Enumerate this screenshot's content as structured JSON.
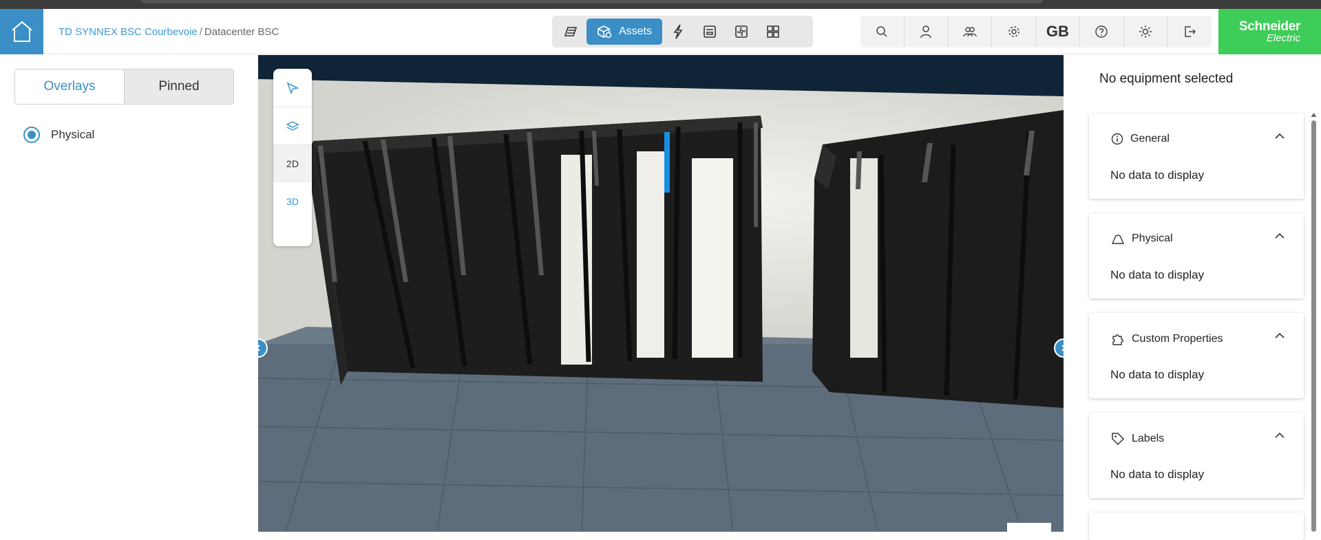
{
  "header": {
    "breadcrumb": {
      "site": "TD SYNNEX BSC Courbevoie",
      "separator": "/",
      "current": "Datacenter BSC"
    },
    "modes": {
      "active_label": "Assets",
      "icons": [
        "rack-icon",
        "assets-icon",
        "power-icon",
        "network-icon",
        "cooling-icon",
        "widgets-icon"
      ]
    },
    "tools": {
      "language": "GB",
      "icons": [
        "search-icon",
        "user-icon",
        "users-icon",
        "gear-icon",
        "help-icon",
        "sun-icon",
        "logout-icon"
      ]
    },
    "brand": {
      "line1": "Schneider",
      "line2": "Electric"
    }
  },
  "left_panel": {
    "tabs": {
      "overlays": "Overlays",
      "pinned": "Pinned"
    },
    "layers": [
      {
        "label": "Physical",
        "selected": true
      }
    ]
  },
  "viewport": {
    "view_2d": "2D",
    "view_3d": "3D"
  },
  "right_panel": {
    "title": "No equipment selected",
    "sections": [
      {
        "title": "General",
        "icon": "info-icon",
        "body": "No data to display"
      },
      {
        "title": "Physical",
        "icon": "physical-icon",
        "body": "No data to display"
      },
      {
        "title": "Custom Properties",
        "icon": "puzzle-icon",
        "body": "No data to display"
      },
      {
        "title": "Labels",
        "icon": "tag-icon",
        "body": "No data to display"
      }
    ]
  },
  "colors": {
    "accent": "#3b8fc6",
    "link": "#3b9ad8",
    "brand_green": "#3dcd58"
  }
}
